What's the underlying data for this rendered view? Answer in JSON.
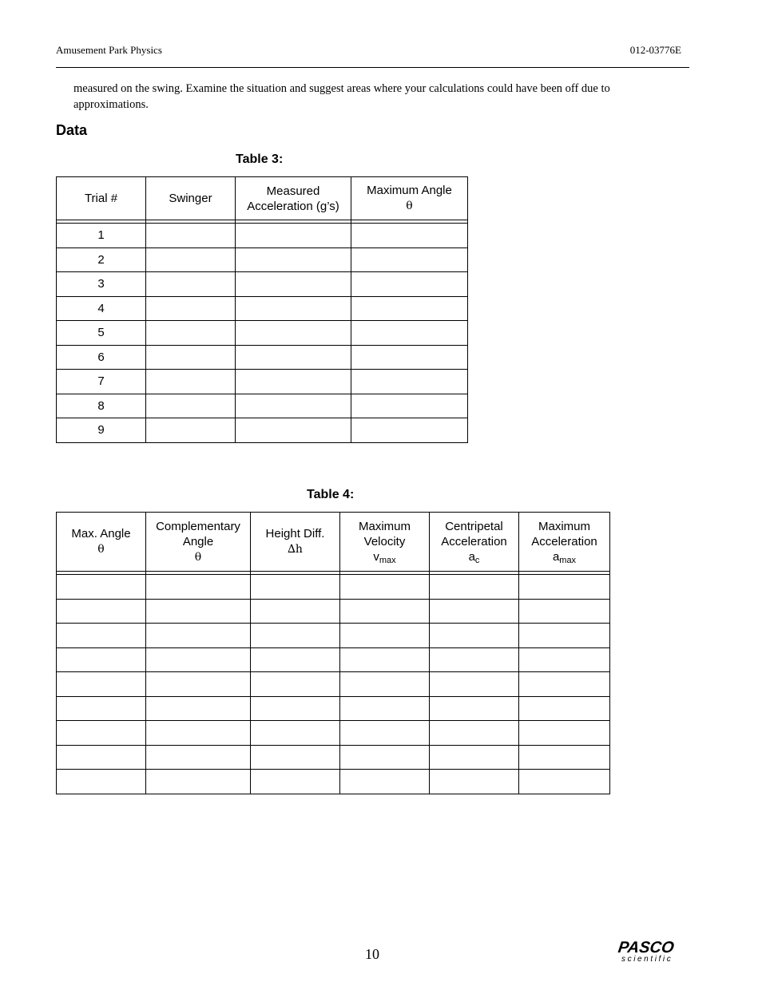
{
  "header": {
    "title": "Amusement Park Physics",
    "doc_number": "012-03776E"
  },
  "intro_text": "measured on the swing. Examine the situation and suggest areas where your calculations could have been off due to approximations.",
  "section_title": "Data",
  "table3": {
    "caption": "Table 3:",
    "headers": [
      {
        "line1": "Trial #",
        "line2": ""
      },
      {
        "line1": "Swinger",
        "line2": ""
      },
      {
        "line1": "Measured",
        "line2": "Acceleration (g’s)"
      },
      {
        "line1": "Maximum Angle",
        "line2": "θ"
      }
    ],
    "rows": [
      [
        "1",
        "",
        "",
        ""
      ],
      [
        "2",
        "",
        "",
        ""
      ],
      [
        "3",
        "",
        "",
        ""
      ],
      [
        "4",
        "",
        "",
        ""
      ],
      [
        "5",
        "",
        "",
        ""
      ],
      [
        "6",
        "",
        "",
        ""
      ],
      [
        "7",
        "",
        "",
        ""
      ],
      [
        "8",
        "",
        "",
        ""
      ],
      [
        "9",
        "",
        "",
        ""
      ]
    ]
  },
  "table4": {
    "caption": "Table 4:",
    "headers": [
      {
        "lines": [
          "Max. Angle"
        ],
        "symbol": "θ",
        "symbol_sub": ""
      },
      {
        "lines": [
          "Complementary",
          "Angle"
        ],
        "symbol": "θ",
        "symbol_sub": ""
      },
      {
        "lines": [
          "Height Diff."
        ],
        "symbol": "∆h",
        "symbol_sub": ""
      },
      {
        "lines": [
          "Maximum",
          "Velocity"
        ],
        "symbol": "v",
        "symbol_sub": "max"
      },
      {
        "lines": [
          "Centripetal",
          "Acceleration"
        ],
        "symbol": "a",
        "symbol_sub": "c"
      },
      {
        "lines": [
          "Maximum",
          "Acceleration"
        ],
        "symbol": "a",
        "symbol_sub": "max"
      }
    ],
    "row_count": 9
  },
  "footer": {
    "page_number": "10",
    "logo_main": "PASCO",
    "logo_sub": "scientific"
  }
}
